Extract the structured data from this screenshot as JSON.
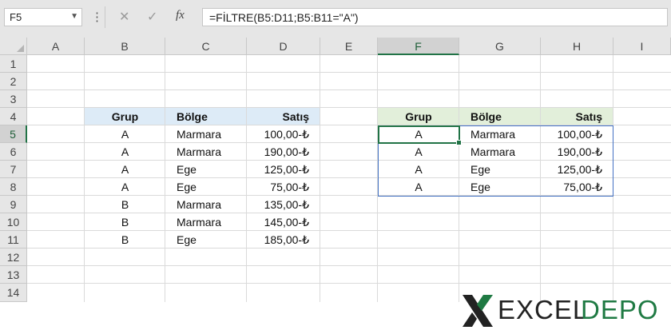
{
  "formula_bar": {
    "name_box": "F5",
    "more_icon": "⋮",
    "cancel_icon": "✕",
    "enter_icon": "✓",
    "fx_icon": "fx",
    "formula": "=FİLTRE(B5:D11;B5:B11=\"A\")"
  },
  "columns": [
    "A",
    "B",
    "C",
    "D",
    "E",
    "F",
    "G",
    "H",
    "I"
  ],
  "rows": [
    "1",
    "2",
    "3",
    "4",
    "5",
    "6",
    "7",
    "8",
    "9",
    "10",
    "11",
    "12",
    "13",
    "14"
  ],
  "selected_column": "F",
  "selected_row": "5",
  "source_table": {
    "headers": [
      "Grup",
      "Bölge",
      "Satış"
    ],
    "rows": [
      [
        "A",
        "Marmara",
        "100,00-₺"
      ],
      [
        "A",
        "Marmara",
        "190,00-₺"
      ],
      [
        "A",
        "Ege",
        "125,00-₺"
      ],
      [
        "A",
        "Ege",
        "75,00-₺"
      ],
      [
        "B",
        "Marmara",
        "135,00-₺"
      ],
      [
        "B",
        "Marmara",
        "145,00-₺"
      ],
      [
        "B",
        "Ege",
        "185,00-₺"
      ]
    ]
  },
  "result_table": {
    "headers": [
      "Grup",
      "Bölge",
      "Satış"
    ],
    "rows": [
      [
        "A",
        "Marmara",
        "100,00-₺"
      ],
      [
        "A",
        "Marmara",
        "190,00-₺"
      ],
      [
        "A",
        "Ege",
        "125,00-₺"
      ],
      [
        "A",
        "Ege",
        "75,00-₺"
      ]
    ]
  },
  "logo": {
    "part1": "EXCEL",
    "part2": "DEPO"
  },
  "colors": {
    "accent_green": "#217346",
    "header_blue": "#ddebf7",
    "header_green": "#e2efda",
    "spill_border": "#4472c4"
  }
}
